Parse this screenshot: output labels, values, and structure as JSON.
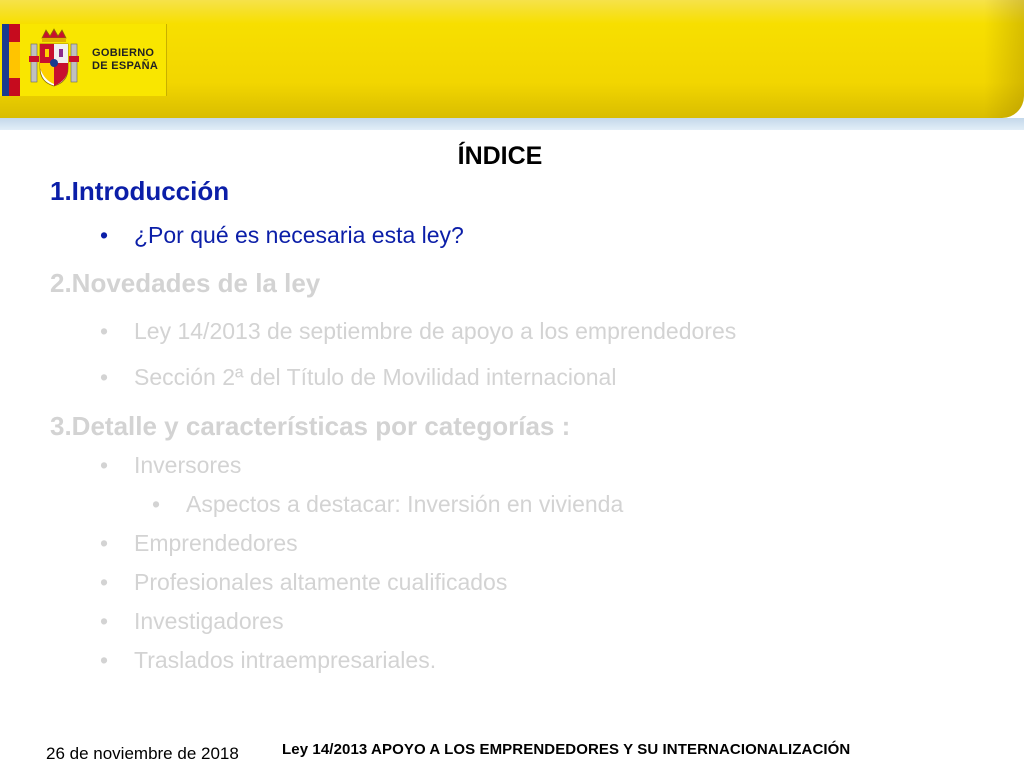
{
  "header": {
    "gov_line1": "GOBIERNO",
    "gov_line2": "DE ESPAÑA"
  },
  "title": "ÍNDICE",
  "sections": [
    {
      "heading": "1.Introducción",
      "items": [
        "¿Por qué es necesaria esta ley?"
      ]
    },
    {
      "heading": "2.Novedades de la ley",
      "items": [
        "Ley 14/2013 de septiembre de apoyo a los emprendedores",
        "Sección 2ª del Título de Movilidad internacional"
      ]
    },
    {
      "heading": "3.Detalle y características por categorías :",
      "items": [
        "Inversores",
        "Aspectos a destacar: Inversión en vivienda",
        "Emprendedores",
        "Profesionales altamente cualificados",
        "Investigadores",
        "Traslados intraempresariales."
      ]
    }
  ],
  "footer": {
    "date": "26 de noviembre de 2018",
    "title": "Ley 14/2013 APOYO A LOS EMPRENDEDORES Y SU INTERNACIONALIZACIÓN"
  },
  "colors": {
    "active": "#0b1ea8",
    "inactive": "#d3d3d3",
    "header_yellow": "#f7df00"
  },
  "bullet_symbol": "•"
}
